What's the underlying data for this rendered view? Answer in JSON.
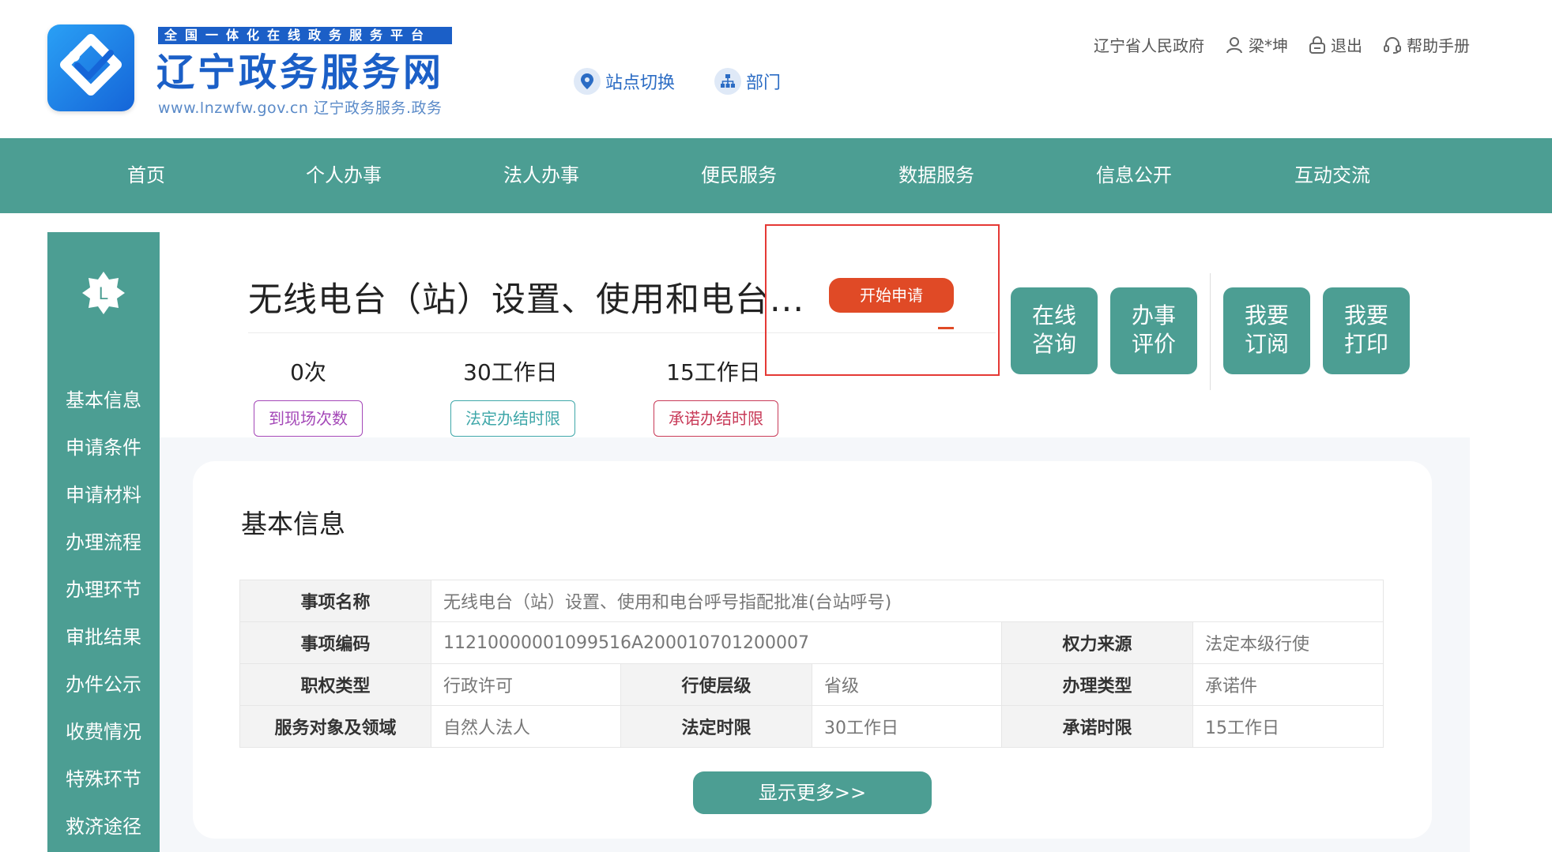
{
  "header": {
    "banner": "全国一体化在线政务服务平台",
    "title": "辽宁政务服务网",
    "url": "www.lnzwfw.gov.cn  辽宁政务服务.政务",
    "site_switch": "站点切换",
    "department": "部门",
    "top_links": {
      "gov": "辽宁省人民政府",
      "user": "梁*坤",
      "logout": "退出",
      "help": "帮助手册"
    }
  },
  "nav": [
    "首页",
    "个人办事",
    "法人办事",
    "便民服务",
    "数据服务",
    "信息公开",
    "互动交流"
  ],
  "sidebar": {
    "badge_letter": "L",
    "items": [
      "基本信息",
      "申请条件",
      "申请材料",
      "办理流程",
      "办理环节",
      "审批结果",
      "办件公示",
      "收费情况",
      "特殊环节",
      "救济途径"
    ]
  },
  "matter": {
    "title": "无线电台（站）设置、使用和电台...",
    "apply_label": "开始申请",
    "stats": [
      {
        "value": "0次",
        "label": "到现场次数",
        "color": "#a448b8"
      },
      {
        "value": "30工作日",
        "label": "法定办结时限",
        "color": "#3fa7a9"
      },
      {
        "value": "15工作日",
        "label": "承诺办结时限",
        "color": "#c83a58"
      }
    ],
    "actions": [
      {
        "line1": "在线",
        "line2": "咨询"
      },
      {
        "line1": "办事",
        "line2": "评价"
      },
      {
        "line1": "我要",
        "line2": "订阅"
      },
      {
        "line1": "我要",
        "line2": "打印"
      }
    ]
  },
  "basic_info": {
    "section_title": "基本信息",
    "rows": {
      "name_label": "事项名称",
      "name_value": "无线电台（站）设置、使用和电台呼号指配批准(台站呼号)",
      "code_label": "事项编码",
      "code_value": "11210000001099516A200010701200007",
      "source_label": "权力来源",
      "source_value": "法定本级行使",
      "type_label": "职权类型",
      "type_value": "行政许可",
      "level_label": "行使层级",
      "level_value": "省级",
      "handle_label": "办理类型",
      "handle_value": "承诺件",
      "target_label": "服务对象及领域",
      "target_value": "自然人法人",
      "legal_label": "法定时限",
      "legal_value": "30工作日",
      "promise_label": "承诺时限",
      "promise_value": "15工作日"
    },
    "more_label": "显示更多>>"
  },
  "colors": {
    "brand_teal": "#4c9e93",
    "apply_red": "#e04a26",
    "brand_blue": "#1b5fc7"
  }
}
